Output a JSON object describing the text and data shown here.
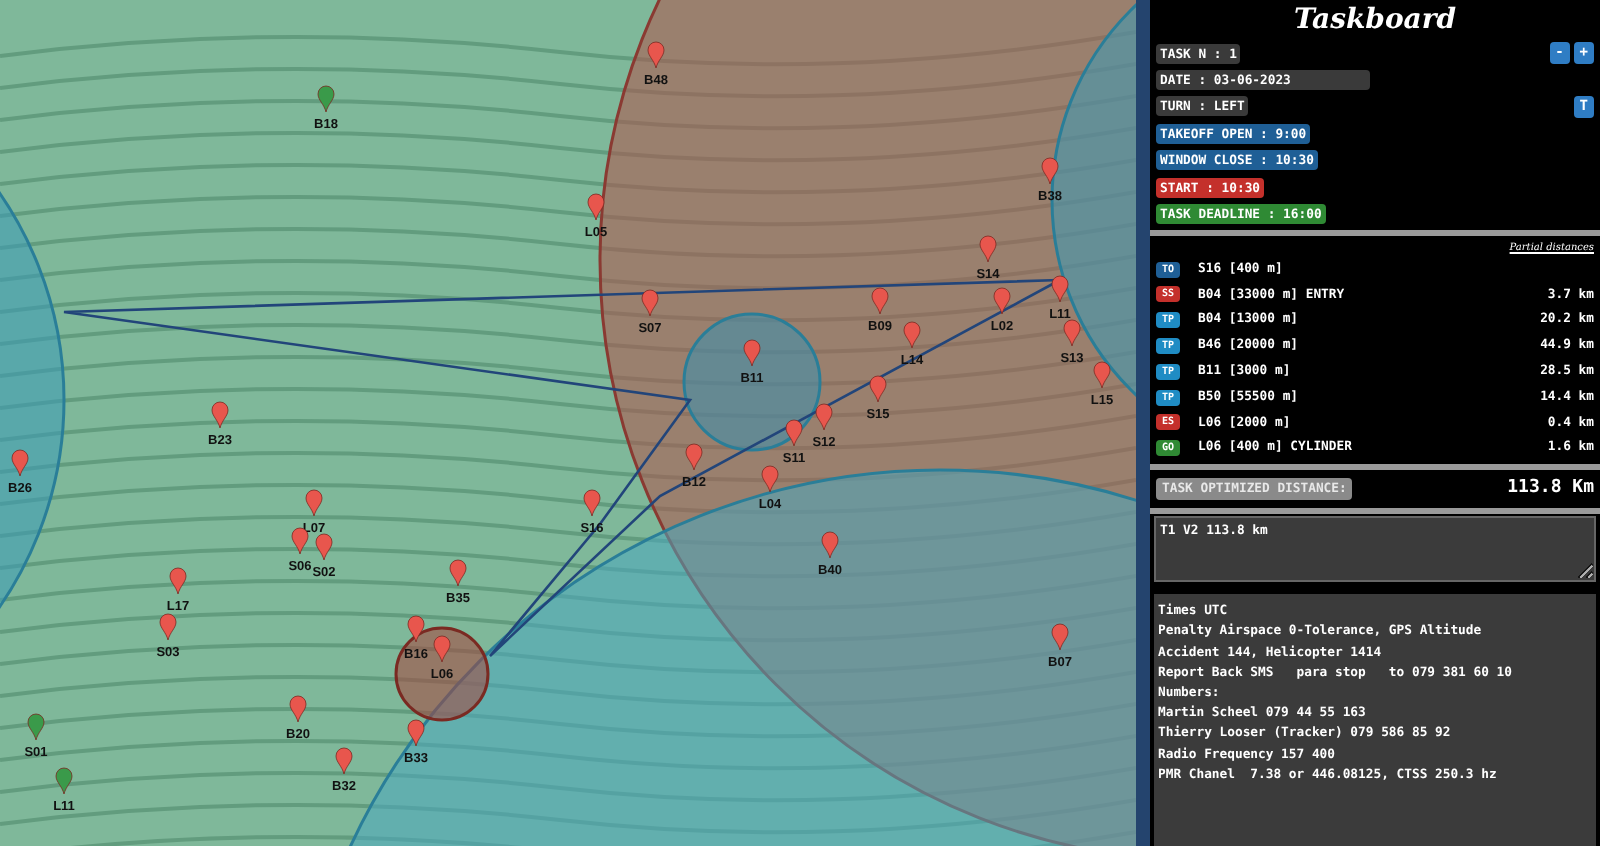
{
  "map": {
    "markers": [
      {
        "label": "B48",
        "color": "#e8564d"
      },
      {
        "label": "B18",
        "color": "#3a9a4a"
      },
      {
        "label": "L05",
        "color": "#e8564d"
      },
      {
        "label": "B38",
        "color": "#e8564d"
      },
      {
        "label": "S14",
        "color": "#e8564d"
      },
      {
        "label": "B09",
        "color": "#e8564d"
      },
      {
        "label": "L02",
        "color": "#e8564d"
      },
      {
        "label": "L11",
        "color": "#e8564d"
      },
      {
        "label": "S13",
        "color": "#e8564d"
      },
      {
        "label": "L14",
        "color": "#e8564d"
      },
      {
        "label": "S07",
        "color": "#e8564d"
      },
      {
        "label": "B11",
        "color": "#e8564d"
      },
      {
        "label": "L15",
        "color": "#e8564d"
      },
      {
        "label": "S15",
        "color": "#e8564d"
      },
      {
        "label": "S12",
        "color": "#e8564d"
      },
      {
        "label": "S11",
        "color": "#e8564d"
      },
      {
        "label": "B12",
        "color": "#e8564d"
      },
      {
        "label": "L04",
        "color": "#e8564d"
      },
      {
        "label": "B23",
        "color": "#e8564d"
      },
      {
        "label": "B26",
        "color": "#e8564d"
      },
      {
        "label": "S16",
        "color": "#e8564d"
      },
      {
        "label": "L07",
        "color": "#e8564d"
      },
      {
        "label": "S06",
        "color": "#e8564d"
      },
      {
        "label": "S02",
        "color": "#e8564d"
      },
      {
        "label": "B40",
        "color": "#e8564d"
      },
      {
        "label": "B35",
        "color": "#e8564d"
      },
      {
        "label": "L17",
        "color": "#e8564d"
      },
      {
        "label": "S03",
        "color": "#e8564d"
      },
      {
        "label": "B16",
        "color": "#e8564d"
      },
      {
        "label": "L06",
        "color": "#e8564d"
      },
      {
        "label": "B07",
        "color": "#e8564d"
      },
      {
        "label": "S01",
        "color": "#3a9a4a"
      },
      {
        "label": "B20",
        "color": "#e8564d"
      },
      {
        "label": "B33",
        "color": "#e8564d"
      },
      {
        "label": "B32",
        "color": "#e8564d"
      },
      {
        "label": "L11",
        "color": "#3a9a4a"
      }
    ]
  },
  "taskboard": {
    "title": "Taskboard",
    "fields": [
      {
        "text": "TASK N : 1",
        "kind": "info"
      },
      {
        "text": "DATE : 03-06-2023",
        "kind": "date"
      },
      {
        "text": "TURN : LEFT",
        "kind": "info"
      },
      {
        "text": "TAKEOFF OPEN : 9:00",
        "kind": "time"
      },
      {
        "text": "WINDOW CLOSE : 10:30",
        "kind": "time"
      },
      {
        "text": "START : 10:30",
        "kind": "start"
      },
      {
        "text": "TASK DEADLINE : 16:00",
        "kind": "deadline"
      }
    ],
    "task_buttons": [
      "-",
      "+"
    ],
    "turn_button": "T",
    "partial_header": "Partial distances",
    "turnpoints": [
      {
        "tag": "TO",
        "kind": "takeoff",
        "name": "S16 [400 m]"
      },
      {
        "tag": "SS",
        "kind": "start",
        "name": "B04 [33000 m] ENTRY",
        "distance": "3.7 km"
      },
      {
        "tag": "TP",
        "kind": "turnpoint",
        "name": "B04 [13000 m]",
        "distance": "20.2 km"
      },
      {
        "tag": "TP",
        "kind": "turnpoint",
        "name": "B46 [20000 m]",
        "distance": "44.9 km"
      },
      {
        "tag": "TP",
        "kind": "turnpoint",
        "name": "B11 [3000 m]",
        "distance": "28.5 km"
      },
      {
        "tag": "TP",
        "kind": "turnpoint",
        "name": "B50 [55500 m]",
        "distance": "14.4 km"
      },
      {
        "tag": "ES",
        "kind": "end",
        "name": "L06 [2000 m]",
        "distance": "0.4 km"
      },
      {
        "tag": "GO",
        "kind": "goal",
        "name": "L06 [400 m] CYLINDER",
        "distance": "1.6 km"
      }
    ],
    "optimized": {
      "label": "TASK OPTIMIZED DISTANCE:",
      "value": "113.8 Km"
    },
    "comment": "T1 V2 113.8 km",
    "notes": [
      "Times UTC",
      "Penalty Airspace 0-Tolerance, GPS Altitude",
      "Accident 144, Helicopter 1414",
      "Report Back SMS   para stop   to 079 381 60 10",
      "Numbers:",
      "Martin Scheel 079 44 55 163",
      "Thierry Looser (Tracker) 079 586 85 92",
      "Radio Frequency 157 400",
      "PMR Chanel  7.38 or 446.08125, CTSS 250.3 hz"
    ]
  }
}
